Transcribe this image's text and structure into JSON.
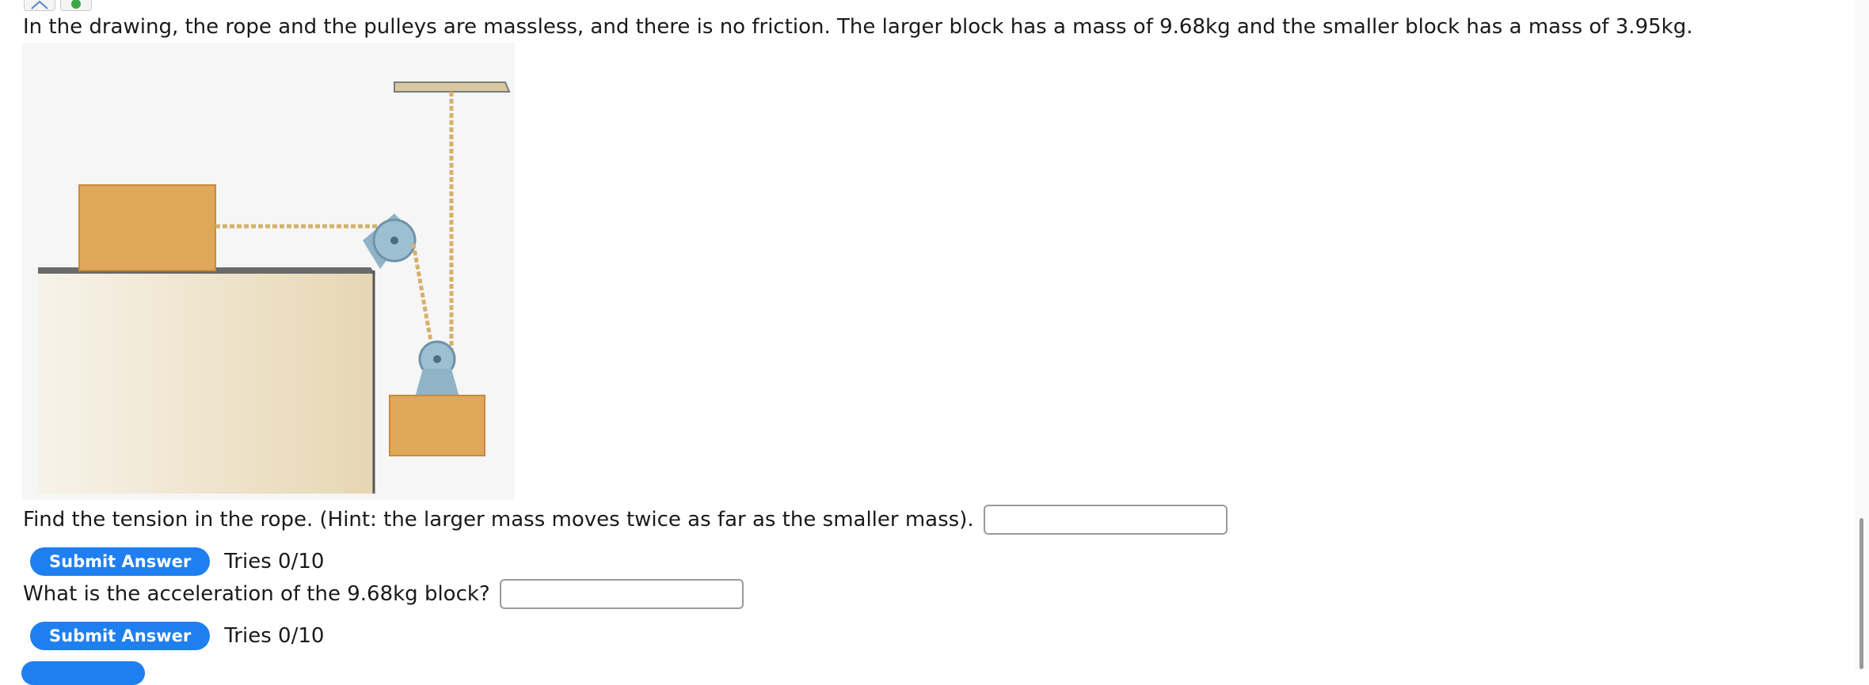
{
  "problem": {
    "text": "In the drawing, the rope and the pulleys are massless, and there is no friction. The larger block has a mass of 9.68kg and the smaller block has a mass of 3.95kg."
  },
  "figure": {
    "colors": {
      "block": "#e0a85a",
      "block_shade": "#c98a3e",
      "pulley": "#8fb4c8",
      "rope": "#d7b06a",
      "table": "#e8d6b0"
    }
  },
  "questions": [
    {
      "text": "Find the tension in the rope. (Hint: the larger mass moves twice as far as the smaller mass).",
      "value": "",
      "submit_label": "Submit Answer",
      "tries": "Tries 0/10"
    },
    {
      "text": "What is the acceleration of the 9.68kg block?",
      "value": "",
      "submit_label": "Submit Answer",
      "tries": "Tries 0/10"
    }
  ]
}
